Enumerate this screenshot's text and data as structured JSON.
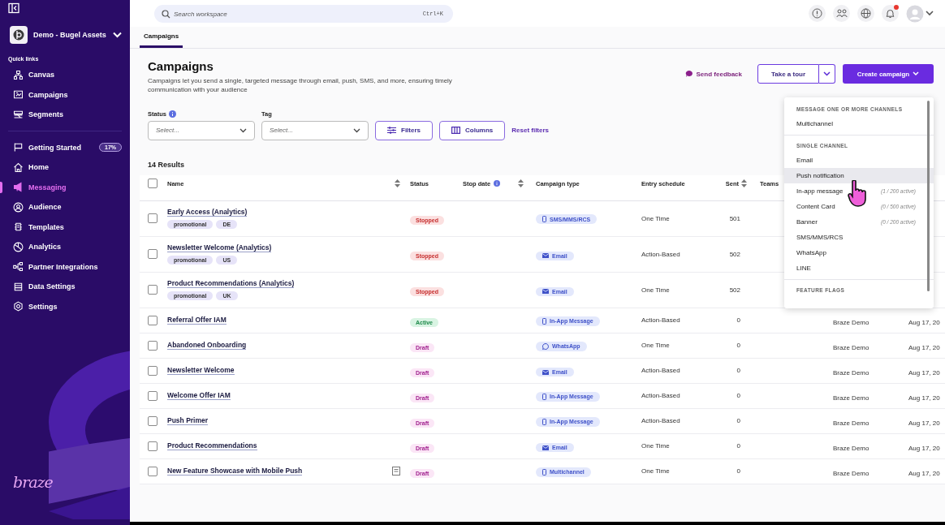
{
  "sidebar": {
    "workspace": "Demo - Bugel Assets",
    "quick_links_heading": "Quick links",
    "quick_links": [
      {
        "label": "Canvas"
      },
      {
        "label": "Campaigns"
      },
      {
        "label": "Segments"
      }
    ],
    "items": [
      {
        "label": "Getting Started",
        "badge": "17%",
        "selected": false
      },
      {
        "label": "Home",
        "selected": false
      },
      {
        "label": "Messaging",
        "selected": true
      },
      {
        "label": "Audience",
        "selected": false
      },
      {
        "label": "Templates",
        "selected": false
      },
      {
        "label": "Analytics",
        "selected": false
      },
      {
        "label": "Partner Integrations",
        "selected": false
      },
      {
        "label": "Data Settings",
        "selected": false
      },
      {
        "label": "Settings",
        "selected": false
      }
    ],
    "logo": "braze"
  },
  "topbar": {
    "search": {
      "placeholder": "Search workspace",
      "shortcut": "Ctrl+K"
    },
    "notification_dot": true
  },
  "tabs": [
    {
      "label": "Campaigns",
      "selected": true
    }
  ],
  "header": {
    "title": "Campaigns",
    "description": "Campaigns let you send a single, targeted message through email, push, SMS, and more, ensuring timely communication with your audience",
    "feedback": "Send feedback",
    "tour": "Take a tour",
    "create": "Create campaign"
  },
  "filters": {
    "status": {
      "label": "Status",
      "placeholder": "Select..."
    },
    "tag": {
      "label": "Tag",
      "placeholder": "Select..."
    },
    "filters_button": "Filters",
    "columns_button": "Columns",
    "reset": "Reset filters"
  },
  "results": "14 Results",
  "table": {
    "select_all_checked": false,
    "columns": [
      "Name",
      "Status",
      "Stop date",
      "Campaign type",
      "Entry schedule",
      "Sent",
      "Teams"
    ],
    "rows": [
      {
        "checked": false,
        "name": "Early Access (Analytics)",
        "tags": [
          "promotional",
          "DE"
        ],
        "status": {
          "label": "Stopped",
          "kind": "stopped"
        },
        "type": {
          "label": "SMS/MMS/RCS",
          "kind": "phone"
        },
        "schedule": "One Time",
        "sent": "501"
      },
      {
        "checked": false,
        "name": "Newsletter Welcome (Analytics)",
        "tags": [
          "promotional",
          "US"
        ],
        "status": {
          "label": "Stopped",
          "kind": "stopped"
        },
        "type": {
          "label": "Email",
          "kind": "email"
        },
        "schedule": "Action-Based",
        "sent": "502"
      },
      {
        "checked": false,
        "name": "Product Recommendations (Analytics)",
        "tags": [
          "promotional",
          "UK"
        ],
        "status": {
          "label": "Stopped",
          "kind": "stopped"
        },
        "type": {
          "label": "Email",
          "kind": "email"
        },
        "schedule": "One Time",
        "sent": "502"
      },
      {
        "checked": false,
        "name": "Referral Offer IAM",
        "tags": [],
        "status": {
          "label": "Active",
          "kind": "active"
        },
        "type": {
          "label": "In-App Message",
          "kind": "phone"
        },
        "schedule": "Action-Based",
        "sent": "0",
        "column_9": "Braze Demo",
        "column_10": "Aug 17, 20"
      },
      {
        "checked": false,
        "name": "Abandoned Onboarding",
        "tags": [],
        "status": {
          "label": "Draft",
          "kind": "draft"
        },
        "type": {
          "label": "WhatsApp",
          "kind": "whatsapp"
        },
        "schedule": "One Time",
        "sent": "0",
        "column_9": "Braze Demo",
        "column_10": "Aug 17, 20"
      },
      {
        "checked": false,
        "name": "Newsletter Welcome",
        "tags": [],
        "status": {
          "label": "Draft",
          "kind": "draft"
        },
        "type": {
          "label": "Email",
          "kind": "email"
        },
        "schedule": "Action-Based",
        "sent": "0",
        "column_9": "Braze Demo",
        "column_10": "Aug 17, 20"
      },
      {
        "checked": false,
        "name": "Welcome Offer IAM",
        "tags": [],
        "status": {
          "label": "Draft",
          "kind": "draft"
        },
        "type": {
          "label": "In-App Message",
          "kind": "phone"
        },
        "schedule": "Action-Based",
        "sent": "0",
        "column_9": "Braze Demo",
        "column_10": "Aug 17, 20"
      },
      {
        "checked": false,
        "name": "Push Primer",
        "tags": [],
        "status": {
          "label": "Draft",
          "kind": "draft"
        },
        "type": {
          "label": "In-App Message",
          "kind": "phone"
        },
        "schedule": "Action-Based",
        "sent": "0",
        "column_9": "Braze Demo",
        "column_10": "Aug 17, 20"
      },
      {
        "checked": false,
        "name": "Product Recommendations",
        "tags": [],
        "status": {
          "label": "Draft",
          "kind": "draft"
        },
        "type": {
          "label": "Email",
          "kind": "email"
        },
        "schedule": "One Time",
        "sent": "0",
        "column_9": "Braze Demo",
        "column_10": "Aug 17, 20"
      },
      {
        "checked": false,
        "name": "New Feature Showcase with Mobile Push",
        "tags": [],
        "status": {
          "label": "Draft",
          "kind": "draft"
        },
        "type": {
          "label": "Multichannel",
          "kind": "phone"
        },
        "schedule": "One Time",
        "sent": "0",
        "column_9": "Braze Demo",
        "column_10": "Aug 17, 20",
        "note": true
      }
    ]
  },
  "menu": {
    "sections": [
      {
        "heading": "MESSAGE ONE OR MORE CHANNELS",
        "items": [
          {
            "label": "Multichannel",
            "hovered": false
          }
        ]
      },
      {
        "heading": "SINGLE CHANNEL",
        "items": [
          {
            "label": "Email",
            "hovered": false
          },
          {
            "label": "Push notification",
            "hovered": true
          },
          {
            "label": "In-app message",
            "count": "(1 / 200 active)",
            "hovered": false
          },
          {
            "label": "Content Card",
            "count": "(0 / 500 active)",
            "hovered": false
          },
          {
            "label": "Banner",
            "count": "(0 / 200 active)",
            "hovered": false
          },
          {
            "label": "SMS/MMS/RCS",
            "hovered": false
          },
          {
            "label": "WhatsApp",
            "hovered": false
          },
          {
            "label": "LINE",
            "hovered": false
          }
        ]
      },
      {
        "heading": "FEATURE FLAGS"
      }
    ]
  }
}
